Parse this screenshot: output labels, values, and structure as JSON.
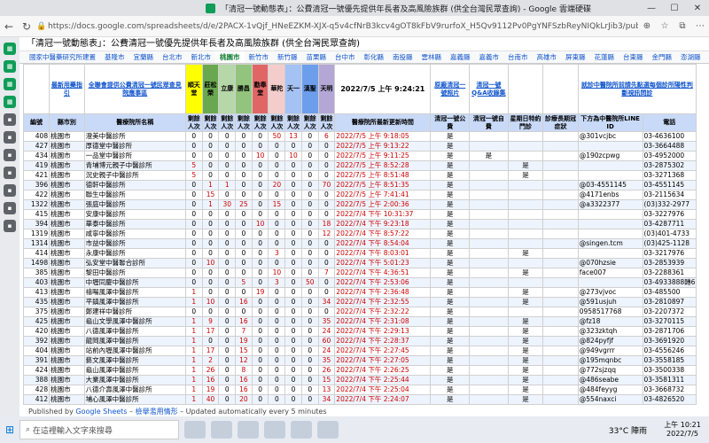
{
  "window": {
    "title": "「清冠一號動態表」：公費清冠一號優先提供年長者及高風險族群 (供全台灣民眾查詢) - Google 雲端硬碟"
  },
  "address": {
    "url": "https://docs.google.com/spreadsheets/d/e/2PACX-1vQjf_HNeEZKM-XJX-q5v4cfNrB3kcv4gOT8kFbV9rurfoX_H5Qv9112Pv0PgYNFSzbReyNIQkLrJib3/pubhtml?..."
  },
  "doc": {
    "title": "「清冠一號動態表」：公費清冠一號優先提供年長者及高風險族群 (供全台灣民眾查詢)"
  },
  "tabs": [
    "國家中醫藥研究所建置",
    "基隆市",
    "宜蘭縣",
    "台北市",
    "新北市",
    "桃園市",
    "新竹市",
    "新竹縣",
    "苗栗縣",
    "台中市",
    "彰化縣",
    "南投縣",
    "雲林縣",
    "嘉義縣",
    "嘉義市",
    "台南市",
    "高雄市",
    "屏東縣",
    "花蓮縣",
    "台東縣",
    "金門縣",
    "澎湖縣"
  ],
  "header": {
    "latest_guide": "最新用藥指引",
    "all_list": "全聯會提供公費清冠一號民眾查見院應事區",
    "brand1": "順天堂",
    "brand2": "莊松榮",
    "brand3": "立康",
    "brand4": "勝昌",
    "brand5": "勸奉堂",
    "brand6": "華陀",
    "brand7": "天一",
    "brand8": "漢聖",
    "brand9": "天明",
    "datetime": "2022/7/5 上午 9:24:21",
    "original_list": "原廠清冠一號照片",
    "qa": "清冠一號Q&A收錄集",
    "line_note": "就診中醫院所前請先點選每個診所陽性判斷視訊問診"
  },
  "columns": [
    "編號",
    "縣市別",
    "醫療院所名稱",
    "剩餘人次",
    "剩餘人次",
    "剩餘人次",
    "剩餘人次",
    "剩餘人次",
    "剩餘人次",
    "剩餘人次",
    "剩餘人次",
    "剩餘人次",
    "醫療院所最新更新時間",
    "清冠一號公費",
    "清冠一號自費",
    "星期日特約門診",
    "診療長期冠症狀",
    "下方為中醫院所LINE ID",
    "電話"
  ],
  "rows": [
    [
      "408",
      "桃園市",
      "澄美中醫診所",
      "0",
      "0",
      "0",
      "0",
      "0",
      "50",
      "13",
      "0",
      "6",
      "2022/7/5 上午 9:18:05",
      "是",
      "",
      "",
      "",
      "@301vcjbc",
      "03-4636100"
    ],
    [
      "427",
      "桃園市",
      "厚德堂中醫診所",
      "0",
      "0",
      "0",
      "0",
      "0",
      "0",
      "0",
      "0",
      "0",
      "2022/7/5 上午 9:13:22",
      "是",
      "",
      "",
      "",
      "",
      "03-3664488"
    ],
    [
      "434",
      "桃園市",
      "一品堂中醫診所",
      "0",
      "0",
      "0",
      "0",
      "10",
      "0",
      "10",
      "0",
      "0",
      "2022/7/5 上午 9:11:25",
      "是",
      "是",
      "",
      "",
      "@190zcpwg",
      "03-4952000"
    ],
    [
      "419",
      "桃園市",
      "青埔博元親子中醫診所",
      "5",
      "0",
      "0",
      "0",
      "0",
      "0",
      "0",
      "0",
      "0",
      "2022/7/5 上午 8:52:28",
      "是",
      "",
      "是",
      "",
      "",
      "03-2875302"
    ],
    [
      "421",
      "桃園市",
      "況史親子中醫診所",
      "5",
      "0",
      "0",
      "0",
      "0",
      "0",
      "0",
      "0",
      "0",
      "2022/7/5 上午 8:51:48",
      "是",
      "",
      "是",
      "",
      "",
      "03-3271368"
    ],
    [
      "396",
      "桃園市",
      "德軒中醫診所",
      "0",
      "1",
      "1",
      "0",
      "0",
      "20",
      "0",
      "0",
      "70",
      "2022/7/5 上午 8:51:35",
      "是",
      "",
      "",
      "",
      "@03-4551145",
      "03-4551145"
    ],
    [
      "422",
      "桃園市",
      "聯生中醫診所",
      "0",
      "15",
      "0",
      "0",
      "0",
      "0",
      "0",
      "0",
      "0",
      "2022/7/5 上午 7:41:41",
      "是",
      "",
      "",
      "",
      "@4171enbs",
      "03-2115634"
    ],
    [
      "1322",
      "桃園市",
      "張庭中醫診所",
      "0",
      "1",
      "30",
      "25",
      "0",
      "15",
      "0",
      "0",
      "0",
      "2022/7/5 上午 2:00:36",
      "是",
      "",
      "",
      "",
      "@a3322377",
      "(03)332-2977"
    ],
    [
      "415",
      "桃園市",
      "安康中醫診所",
      "0",
      "0",
      "0",
      "0",
      "0",
      "0",
      "0",
      "0",
      "0",
      "2022/7/4 下午 10:31:37",
      "是",
      "",
      "",
      "",
      "",
      "03-3227976"
    ],
    [
      "394",
      "桃園市",
      "華泰中醫診所",
      "0",
      "0",
      "0",
      "0",
      "10",
      "0",
      "0",
      "0",
      "18",
      "2022/7/4 下午 9:23:18",
      "是",
      "",
      "",
      "",
      "",
      "03-4287711"
    ],
    [
      "1319",
      "桃園市",
      "咸寧中醫診所",
      "0",
      "0",
      "0",
      "0",
      "0",
      "0",
      "0",
      "0",
      "12",
      "2022/7/4 下午 8:57:22",
      "是",
      "",
      "",
      "",
      "",
      "(03)401-4733"
    ],
    [
      "1314",
      "桃園市",
      "市益中醫診所",
      "0",
      "0",
      "0",
      "0",
      "0",
      "0",
      "0",
      "0",
      "0",
      "2022/7/4 下午 8:54:04",
      "是",
      "",
      "",
      "",
      "@singen.tcm",
      "(03)425-1128"
    ],
    [
      "414",
      "桃園市",
      "永康中醫診所",
      "0",
      "0",
      "0",
      "0",
      "0",
      "3",
      "0",
      "0",
      "0",
      "2022/7/4 下午 8:03:01",
      "是",
      "",
      "是",
      "",
      "",
      "03-3217976"
    ],
    [
      "1498",
      "桃園市",
      "弘安堂中醫聯合診所",
      "0",
      "10",
      "0",
      "0",
      "0",
      "0",
      "0",
      "0",
      "0",
      "2022/7/4 下午 5:01:23",
      "是",
      "",
      "",
      "",
      "@070hzsie",
      "03-2853939"
    ],
    [
      "385",
      "桃園市",
      "黎田中醫診所",
      "0",
      "0",
      "0",
      "0",
      "0",
      "10",
      "0",
      "0",
      "7",
      "2022/7/4 下午 4:36:51",
      "是",
      "",
      "是",
      "",
      "face007",
      "03-2288361"
    ],
    [
      "403",
      "桃園市",
      "中壢同慶中醫診所",
      "0",
      "0",
      "0",
      "5",
      "0",
      "3",
      "0",
      "50",
      "0",
      "2022/7/4 下午 2:53:06",
      "是",
      "",
      "",
      "",
      "",
      "03-4933888轉6"
    ],
    [
      "413",
      "桃園市",
      "禧暘風澤中醫診所",
      "1",
      "0",
      "0",
      "0",
      "19",
      "0",
      "0",
      "0",
      "0",
      "2022/7/4 下午 2:36:48",
      "是",
      "",
      "是",
      "",
      "@273vjvoc",
      "03-485500"
    ],
    [
      "435",
      "桃園市",
      "平鎮風澤中醫診所",
      "1",
      "10",
      "0",
      "16",
      "0",
      "0",
      "0",
      "0",
      "34",
      "2022/7/4 下午 2:32:55",
      "是",
      "",
      "是",
      "",
      "@591usjuh",
      "03-2810897"
    ],
    [
      "375",
      "桃園市",
      "鄭建祥中醫診所",
      "0",
      "0",
      "0",
      "0",
      "0",
      "0",
      "0",
      "0",
      "0",
      "2022/7/4 下午 2:32:22",
      "是",
      "",
      "",
      "",
      "0958517768",
      "03-2207372"
    ],
    [
      "425",
      "桃園市",
      "龜山文學風澤中醫診所",
      "1",
      "9",
      "0",
      "16",
      "0",
      "0",
      "0",
      "0",
      "35",
      "2022/7/4 下午 2:31:08",
      "是",
      "",
      "是",
      "",
      "@fz18",
      "03-3270115"
    ],
    [
      "420",
      "桃園市",
      "八德風澤中醫診所",
      "1",
      "17",
      "0",
      "7",
      "0",
      "0",
      "0",
      "0",
      "24",
      "2022/7/4 下午 2:29:13",
      "是",
      "",
      "是",
      "",
      "@323zktqh",
      "03-2871706"
    ],
    [
      "392",
      "桃園市",
      "龍岡風澤中醫診所",
      "1",
      "0",
      "0",
      "19",
      "0",
      "0",
      "0",
      "0",
      "60",
      "2022/7/4 下午 2:28:37",
      "是",
      "",
      "是",
      "",
      "@824pyfjf",
      "03-3691920"
    ],
    [
      "404",
      "桃園市",
      "站前內壢風澤中醫診所",
      "1",
      "17",
      "0",
      "15",
      "0",
      "0",
      "0",
      "0",
      "24",
      "2022/7/4 下午 2:27:45",
      "是",
      "",
      "是",
      "",
      "@949vgrrr",
      "03-4556246"
    ],
    [
      "391",
      "桃園市",
      "藝文風澤中醫診所",
      "1",
      "2",
      "0",
      "12",
      "0",
      "0",
      "0",
      "0",
      "35",
      "2022/7/4 下午 2:27:05",
      "是",
      "",
      "是",
      "",
      "@195mqnbc",
      "03-3558185"
    ],
    [
      "424",
      "桃園市",
      "龜山風澤中醫診所",
      "1",
      "26",
      "0",
      "8",
      "0",
      "0",
      "0",
      "0",
      "26",
      "2022/7/4 下午 2:26:25",
      "是",
      "",
      "是",
      "",
      "@772sjzqq",
      "03-3500338"
    ],
    [
      "388",
      "桃園市",
      "大業風澤中醫診所",
      "1",
      "16",
      "0",
      "16",
      "0",
      "0",
      "0",
      "0",
      "15",
      "2022/7/4 下午 2:25:44",
      "是",
      "",
      "是",
      "",
      "@486seabe",
      "03-3581311"
    ],
    [
      "428",
      "桃園市",
      "八德介壽風澤中醫診所",
      "1",
      "19",
      "0",
      "16",
      "0",
      "0",
      "0",
      "0",
      "13",
      "2022/7/4 下午 2:25:04",
      "是",
      "",
      "是",
      "",
      "@484feyyg",
      "03-3668732"
    ],
    [
      "412",
      "桃園市",
      "埔心風澤中醫診所",
      "1",
      "40",
      "0",
      "20",
      "0",
      "0",
      "0",
      "0",
      "34",
      "2022/7/4 下午 2:24:07",
      "是",
      "",
      "是",
      "",
      "@554naxci",
      "03-4826520"
    ]
  ],
  "footer": {
    "published_by": "Published by",
    "google_sheets": "Google Sheets",
    "report_abuse": "檢舉濫用情形",
    "updated": "Updated automatically every 5 minutes"
  },
  "taskbar": {
    "search_placeholder": "在這裡輸入文字來搜尋",
    "weather": "33°C 陣雨",
    "time": "上午 10:21",
    "date": "2022/7/5"
  }
}
